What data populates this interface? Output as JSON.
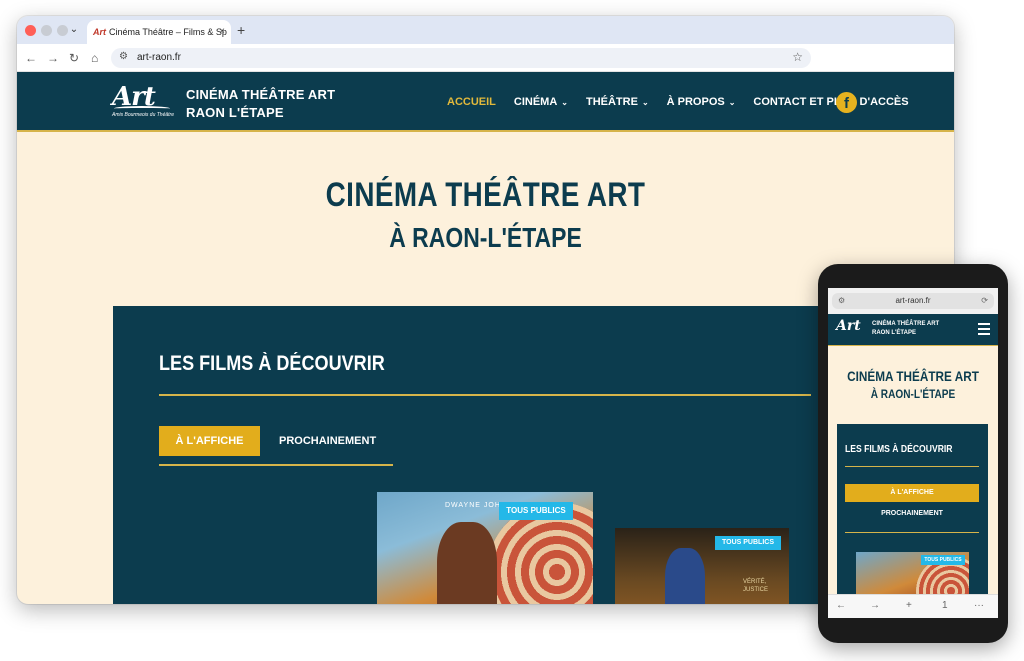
{
  "browser": {
    "tab_title": "Cinéma Théâtre – Films & Sp",
    "tab_favicon": "Art",
    "tab_close": "×",
    "new_tab": "+",
    "url": "art-raon.fr",
    "icons": {
      "back": "←",
      "forward": "→",
      "reload": "↻",
      "home": "⌂",
      "site_info": "⚙",
      "bookmark": "☆",
      "tab_menu": "⌄"
    }
  },
  "header": {
    "logo_text": "Art",
    "logo_subtitle": "Amis Bourmeois du Théâtre",
    "brand_line1": "CINÉMA THÉÂTRE ART",
    "brand_line2": "RAON L'ÉTAPE",
    "nav": [
      {
        "label": "ACCUEIL",
        "active": true,
        "caret": ""
      },
      {
        "label": "CINÉMA",
        "active": false,
        "caret": "⌄"
      },
      {
        "label": "THÉÂTRE",
        "active": false,
        "caret": "⌄"
      },
      {
        "label": "À PROPOS",
        "active": false,
        "caret": "⌄"
      },
      {
        "label": "CONTACT ET PLAN D'ACCÈS",
        "active": false,
        "caret": ""
      }
    ],
    "facebook_glyph": "f",
    "accent_color": "#e2b93b",
    "header_bg": "#0c3c4e"
  },
  "hero": {
    "line1": "CINÉMA THÉÂTRE ART",
    "line2": "À RAON-L'ÉTAPE"
  },
  "films": {
    "title": "LES FILMS À DÉCOUVRIR",
    "tab_active": "À L'AFFICHE",
    "tab_other": "PROCHAINEMENT",
    "posters": [
      {
        "badge": "TOUS PUBLICS",
        "credit": "DWAYNE JOHNSON"
      },
      {
        "badge": "TOUS PUBLICS",
        "credit": "VÉRITÉ, JUSTICE"
      }
    ],
    "badge_color": "#24b8e8"
  },
  "mobile": {
    "url": "art-raon.fr",
    "logo_text": "Art",
    "brand_line1": "CINÉMA THÉÂTRE ART",
    "brand_line2": "RAON L'ÉTAPE",
    "hero_line1": "CINÉMA THÉÂTRE ART",
    "hero_line2": "À RAON-L'ÉTAPE",
    "films_title": "LES FILMS À DÉCOUVRIR",
    "tab_active": "À L'AFFICHE",
    "tab_other": "PROCHAINEMENT",
    "badge": "TOUS PUBLICS",
    "bottom_icons": {
      "back": "←",
      "forward": "→",
      "new_tab": "+",
      "tabs_count": "1",
      "more": "···"
    },
    "url_icons": {
      "left": "⚙",
      "right": "⟳"
    }
  }
}
